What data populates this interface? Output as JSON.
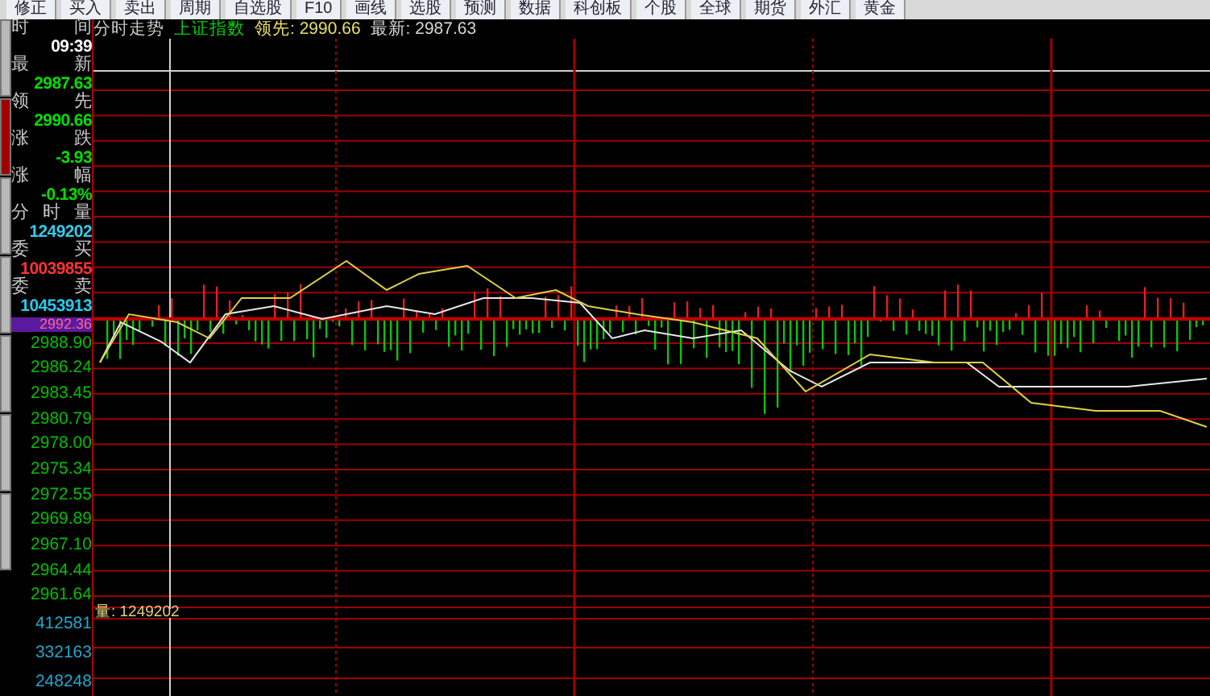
{
  "toolbar": {
    "buttons": [
      "修正",
      "买入",
      "卖出",
      "周期",
      "自选股",
      "F10",
      "画线",
      "选股",
      "预测",
      "数据",
      "科创板",
      "个股",
      "全球",
      "期货",
      "外汇",
      "黄金"
    ]
  },
  "side_tabs": [
    {
      "selected": false
    },
    {
      "selected": true
    },
    {
      "selected": false
    },
    {
      "selected": false
    },
    {
      "selected": false
    },
    {
      "selected": false
    },
    {
      "selected": false
    }
  ],
  "chart_header": {
    "title": "分时走势",
    "index_name": "上证指数",
    "lead": "领先: 2990.66",
    "latest": "最新: 2987.63"
  },
  "quote_panel": [
    {
      "label": [
        "时",
        "间"
      ],
      "value": "09:39",
      "color": "#ffffff"
    },
    {
      "label": [
        "最",
        "新"
      ],
      "value": "2987.63",
      "color": "#00e000"
    },
    {
      "label": [
        "领",
        "先"
      ],
      "value": "2990.66",
      "color": "#00e000"
    },
    {
      "label": [
        "涨",
        "跌"
      ],
      "value": "-3.93",
      "color": "#00e000"
    },
    {
      "label": [
        "涨",
        "幅"
      ],
      "value": "-0.13%",
      "color": "#00e000"
    },
    {
      "label": [
        "分",
        "时",
        "量"
      ],
      "value": "1249202",
      "color": "#33ccee"
    },
    {
      "label": [
        "委",
        "买"
      ],
      "value": "10039855",
      "color": "#ff3333"
    },
    {
      "label": [
        "委",
        "卖"
      ],
      "value": "10453913",
      "color": "#22ccf0"
    }
  ],
  "highlight_price": "2992.36",
  "price_axis": [
    "2988.90",
    "2986.24",
    "2983.45",
    "2980.79",
    "2978.00",
    "2975.34",
    "2972.55",
    "2969.89",
    "2967.10",
    "2964.44",
    "2961.64"
  ],
  "volume_header": "量: 1249202",
  "volume_axis": [
    "412581",
    "332163",
    "248248"
  ]
}
